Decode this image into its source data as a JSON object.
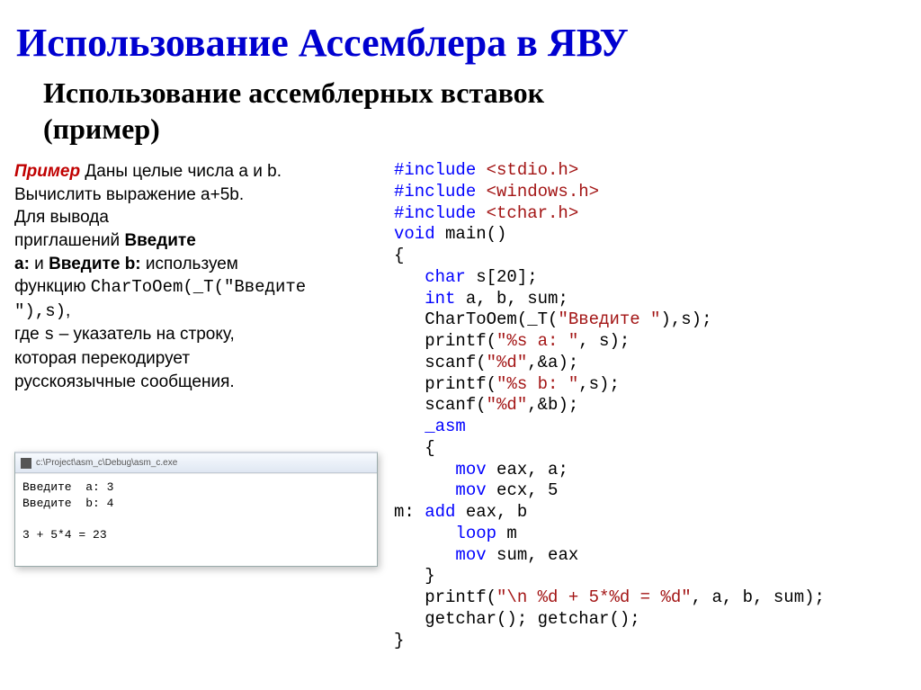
{
  "title": "Использование Ассемблера в ЯВУ",
  "subtitle": "Использование ассемблерных вставок\n(пример)",
  "left": {
    "example_word": "Пример",
    "line1_rest": " Даны целые числа a и b.",
    "line2": "Вычислить выражение a+5b.",
    "line3": "Для вывода",
    "line4_a": "приглашений ",
    "line4_b_bold": "Введите",
    "line5_a_bold": "a:",
    "line5_mid": " и ",
    "line5_b_bold": "Введите b:",
    "line5_rest": " используем",
    "line6_a": "функцию ",
    "line6_code": "CharToOem(_T(\"Введите",
    "line7_code": "\"),s)",
    "line7_rest": ",",
    "line8_a": "где ",
    "line8_s": "s",
    "line8_rest": " – указатель на строку,",
    "line9": "которая перекодирует",
    "line10": "русскоязычные сообщения."
  },
  "console": {
    "title": "c:\\Project\\asm_c\\Debug\\asm_c.exe",
    "body": "Введите  a: 3\nВведите  b: 4\n\n3 + 5*4 = 23"
  },
  "code": {
    "l1_a": "#include",
    "l1_b": " <stdio.h>",
    "l2_a": "#include",
    "l2_b": " <windows.h>",
    "l3_a": "#include",
    "l3_b": " <tchar.h>",
    "l4_a": "void",
    "l4_b": " main()",
    "l5": "{",
    "l6_a": "   ",
    "l6_b": "char",
    "l6_c": " s[20];",
    "l7_a": "   ",
    "l7_b": "int",
    "l7_c": " a, b, sum;",
    "l8_a": "   CharToOem(_T(",
    "l8_b": "\"Введите \"",
    "l8_c": "),s);",
    "l9_a": "   printf(",
    "l9_b": "\"%s a: \"",
    "l9_c": ", s);",
    "l10_a": "   scanf(",
    "l10_b": "\"%d\"",
    "l10_c": ",&a);",
    "l11_a": "   printf(",
    "l11_b": "\"%s b: \"",
    "l11_c": ",s);",
    "l12_a": "   scanf(",
    "l12_b": "\"%d\"",
    "l12_c": ",&b);",
    "l13_a": "   ",
    "l13_b": "_asm",
    "l14": "   {",
    "l15_a": "      ",
    "l15_b": "mov",
    "l15_c": " eax, a;",
    "l16_a": "      ",
    "l16_b": "mov",
    "l16_c": " ecx, 5",
    "l17_a": "m: ",
    "l17_b": "add",
    "l17_c": " eax, b",
    "l18_a": "      ",
    "l18_b": "loop",
    "l18_c": " m",
    "l19_a": "      ",
    "l19_b": "mov",
    "l19_c": " sum, eax",
    "l20": "   }",
    "l21_a": "   printf(",
    "l21_b": "\"\\n %d + 5*%d = %d\"",
    "l21_c": ", a, b, sum);",
    "l22": "   getchar(); getchar();",
    "l23": "}"
  }
}
